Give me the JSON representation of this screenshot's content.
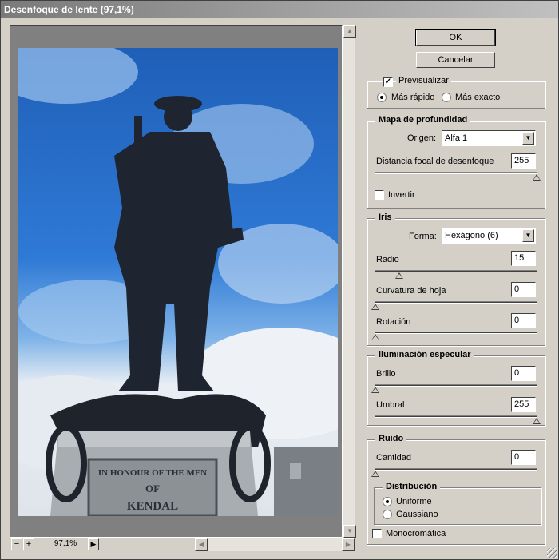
{
  "window": {
    "title": "Desenfoque de lente (97,1%)"
  },
  "preview": {
    "photo_alt": "statue",
    "plaque_line1": "IN HONOUR OF THE MEN",
    "plaque_line2": "OF",
    "plaque_line3": "KENDAL"
  },
  "zoom": {
    "minus": "−",
    "plus": "+",
    "value": "97,1%",
    "play": "▶"
  },
  "buttons": {
    "ok": "OK",
    "cancel": "Cancelar"
  },
  "preview_opts": {
    "preview_label": "Previsualizar",
    "preview_checked": true,
    "faster": "Más rápido",
    "more_accurate": "Más exacto"
  },
  "depth_map": {
    "title": "Mapa de profundidad",
    "source_label": "Origen:",
    "source_value": "Alfa 1",
    "focal_label": "Distancia focal de desenfoque",
    "focal_value": "255",
    "focal_fraction": 1.0,
    "invert_label": "Invertir"
  },
  "iris": {
    "title": "Iris",
    "shape_label": "Forma:",
    "shape_value": "Hexágono (6)",
    "radius_label": "Radio",
    "radius_value": "15",
    "radius_fraction": 0.15,
    "curvature_label": "Curvatura de hoja",
    "curvature_value": "0",
    "curvature_fraction": 0,
    "rotation_label": "Rotación",
    "rotation_value": "0",
    "rotation_fraction": 0
  },
  "specular": {
    "title": "Iluminación especular",
    "brightness_label": "Brillo",
    "brightness_value": "0",
    "brightness_fraction": 0,
    "threshold_label": "Umbral",
    "threshold_value": "255",
    "threshold_fraction": 1.0
  },
  "noise": {
    "title": "Ruido",
    "amount_label": "Cantidad",
    "amount_value": "0",
    "amount_fraction": 0,
    "distribution_title": "Distribución",
    "uniform": "Uniforme",
    "gaussian": "Gaussiano",
    "mono_label": "Monocromática"
  },
  "icons": {
    "check": "✓",
    "up_arrow": "▲",
    "down_arrow": "▼",
    "left_arrow": "◀",
    "right_arrow": "▶"
  }
}
